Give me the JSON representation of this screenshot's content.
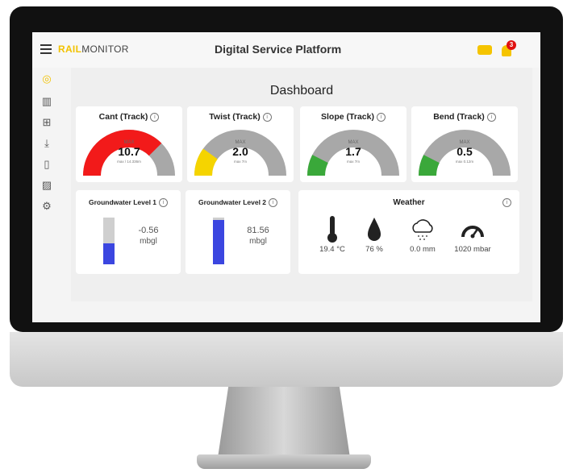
{
  "header": {
    "logo_accent": "RAIL",
    "logo_text": "MONITOR",
    "title": "Digital Service Platform",
    "notification_count": "3"
  },
  "sidebar": {
    "items": [
      {
        "icon": "home-icon"
      },
      {
        "icon": "bar-chart-icon"
      },
      {
        "icon": "map-icon"
      },
      {
        "icon": "download-icon"
      },
      {
        "icon": "document-icon"
      },
      {
        "icon": "image-icon"
      },
      {
        "icon": "settings-icon"
      }
    ]
  },
  "page": {
    "title": "Dashboard"
  },
  "gauges": [
    {
      "title": "Cant (Track)",
      "max_label": "MAX",
      "value": "10.7",
      "sub": "max / 14.336m",
      "level": 0.75,
      "color": "#f21a1a"
    },
    {
      "title": "Twist (Track)",
      "max_label": "MAX",
      "value": "2.0",
      "sub": "max 7m",
      "level": 0.2,
      "color": "#f5d400"
    },
    {
      "title": "Slope (Track)",
      "max_label": "MAX",
      "value": "1.7",
      "sub": "max 7m",
      "level": 0.15,
      "color": "#3aa83a"
    },
    {
      "title": "Bend (Track)",
      "max_label": "MAX",
      "value": "0.5",
      "sub": "max 0.12m",
      "level": 0.15,
      "color": "#3aa83a"
    }
  ],
  "groundwater": [
    {
      "title": "Groundwater Level 1",
      "value": "-0.56",
      "unit": "mbgl",
      "level": 0.45
    },
    {
      "title": "Groundwater Level 2",
      "value": "81.56",
      "unit": "mbgl",
      "level": 0.95
    }
  ],
  "weather": {
    "title": "Weather",
    "items": [
      {
        "icon": "thermometer-icon",
        "value": "19.4 °C"
      },
      {
        "icon": "humidity-drop-icon",
        "value": "76 %"
      },
      {
        "icon": "rain-cloud-icon",
        "value": "0.0 mm"
      },
      {
        "icon": "pressure-gauge-icon",
        "value": "1020 mbar"
      }
    ]
  }
}
